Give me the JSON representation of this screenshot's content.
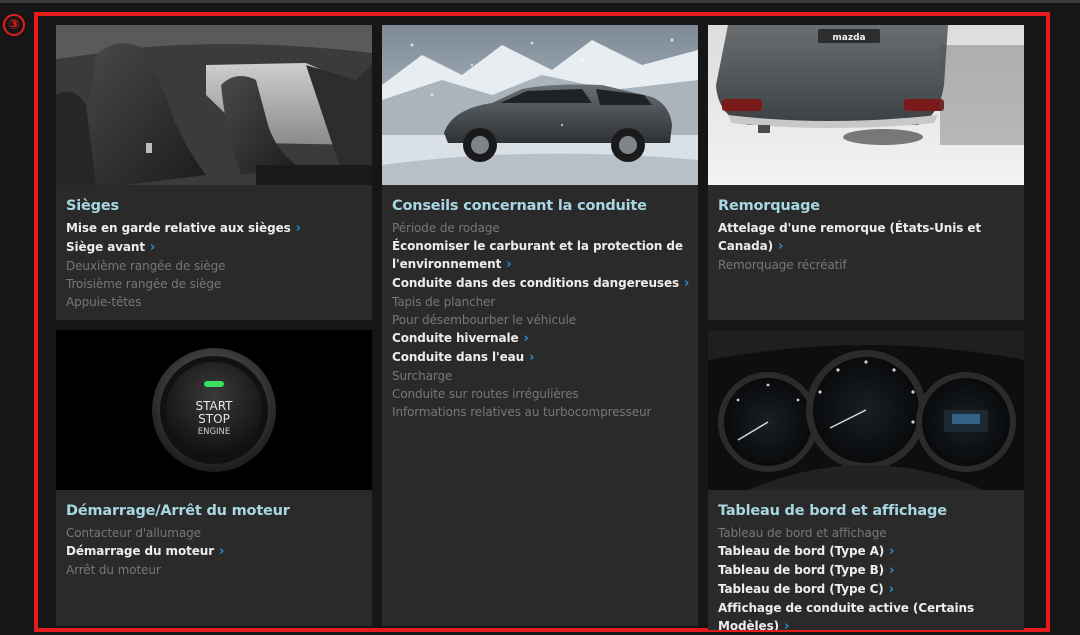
{
  "marker": "③",
  "cards": {
    "sieges": {
      "title": "Sièges",
      "items": [
        {
          "label": "Mise en garde relative aux sièges",
          "link": true
        },
        {
          "label": "Siège avant",
          "link": true
        },
        {
          "label": "Deuxième rangée de siège",
          "link": false
        },
        {
          "label": "Troisième rangée de siège",
          "link": false
        },
        {
          "label": "Appuie-têtes",
          "link": false
        }
      ]
    },
    "conduite": {
      "title": "Conseils concernant la conduite",
      "items": [
        {
          "label": "Période de rodage",
          "link": false
        },
        {
          "label": "Économiser le carburant et la protection de l'environnement",
          "link": true
        },
        {
          "label": "Conduite dans des conditions dangereuses",
          "link": true
        },
        {
          "label": "Tapis de plancher",
          "link": false
        },
        {
          "label": "Pour désembourber le véhicule",
          "link": false
        },
        {
          "label": "Conduite hivernale",
          "link": true
        },
        {
          "label": "Conduite dans l'eau",
          "link": true
        },
        {
          "label": "Surcharge",
          "link": false
        },
        {
          "label": "Conduite sur routes irrégulières",
          "link": false
        },
        {
          "label": "Informations relatives au turbocompresseur",
          "link": false
        }
      ]
    },
    "remorquage": {
      "title": "Remorquage",
      "items": [
        {
          "label": "Attelage d'une remorque (États-Unis et Canada)",
          "link": true
        },
        {
          "label": "Remorquage récréatif",
          "link": false
        }
      ]
    },
    "demarrage": {
      "title": "Démarrage/Arrêt du moteur",
      "button_text": [
        "START",
        "STOP",
        "ENGINE"
      ],
      "items": [
        {
          "label": "Contacteur d'allumage",
          "link": false
        },
        {
          "label": "Démarrage du moteur",
          "link": true
        },
        {
          "label": "Arrêt du moteur",
          "link": false
        }
      ]
    },
    "tableau": {
      "title": "Tableau de bord et affichage",
      "items": [
        {
          "label": "Tableau de bord et affichage",
          "link": false
        },
        {
          "label": "Tableau de bord (Type A)",
          "link": true
        },
        {
          "label": "Tableau de bord (Type B)",
          "link": true
        },
        {
          "label": "Tableau de bord (Type C)",
          "link": true
        },
        {
          "label": "Affichage de conduite active (Certains Modèles)",
          "link": true
        }
      ]
    }
  },
  "vehicle_badge": "mazda",
  "chevron_icon": "chevron-right-icon",
  "colors": {
    "title": "#a8d6e2",
    "link": "#ededed",
    "dim": "#777777",
    "chevron": "#2a8fd4",
    "frame": "#e51c1c"
  }
}
